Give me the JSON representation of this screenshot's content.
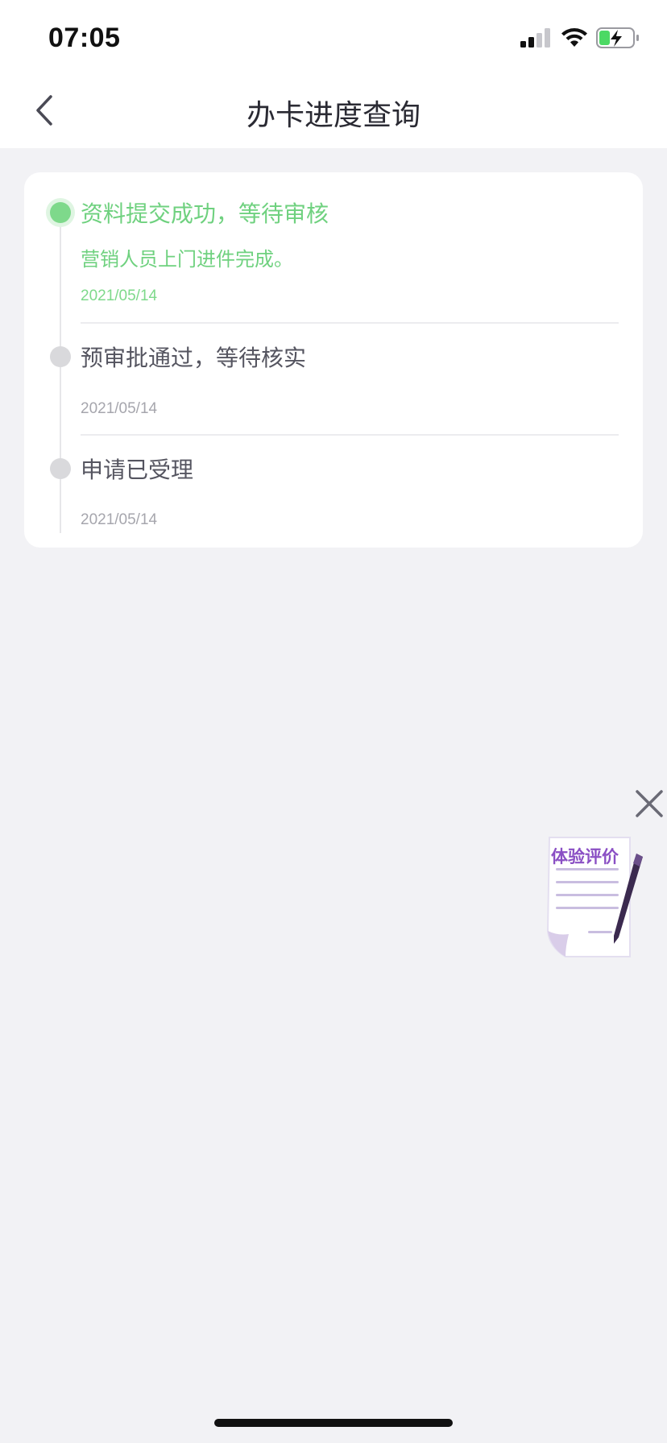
{
  "status_bar": {
    "time": "07:05",
    "icons": [
      "signal-icon",
      "wifi-icon",
      "battery-charging-icon"
    ],
    "battery_color": "#4cd964"
  },
  "nav": {
    "back_icon": "chevron-left-icon",
    "title": "办卡进度查询"
  },
  "timeline": {
    "accent_color": "#6fd17f",
    "steps": [
      {
        "title": "资料提交成功，等待审核",
        "desc": "营销人员上门进件完成。",
        "date": "2021/05/14",
        "active": true
      },
      {
        "title": "预审批通过，等待核实",
        "desc": "",
        "date": "2021/05/14",
        "active": false
      },
      {
        "title": "申请已受理",
        "desc": "",
        "date": "2021/05/14",
        "active": false
      }
    ]
  },
  "floating": {
    "close_icon": "close-icon",
    "eval_label": "体验评价",
    "eval_icon": "document-pen-icon"
  }
}
